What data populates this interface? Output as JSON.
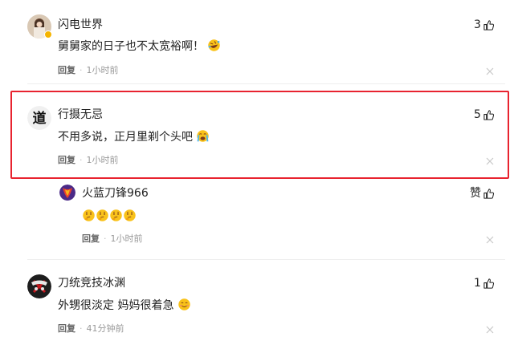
{
  "comments": [
    {
      "username": "闪电世界",
      "text": "舅舅家的日子也不太宽裕啊！",
      "emoji": "rofl-emoji",
      "reply_label": "回复",
      "time": "1小时前",
      "likes": "3"
    },
    {
      "username": "行摄无忌",
      "text": "不用多说，正月里剃个头吧",
      "emoji": "loudly-crying-emoji",
      "reply_label": "回复",
      "time": "1小时前",
      "likes": "5",
      "avatar_text": "道"
    },
    {
      "username": "火蓝刀锋966",
      "text": "",
      "emoji": "thinking-emoji x4",
      "reply_label": "回复",
      "time": "1小时前",
      "likes": "赞"
    },
    {
      "username": "刀统竞技冰渊",
      "text": "外甥很淡定 妈妈很着急",
      "emoji": "slightly-smiling-emoji",
      "reply_label": "回复",
      "time": "41分钟前",
      "likes": "1"
    }
  ],
  "colors": {
    "highlight": "#e8232f",
    "meta": "#999999",
    "text": "#222222"
  }
}
